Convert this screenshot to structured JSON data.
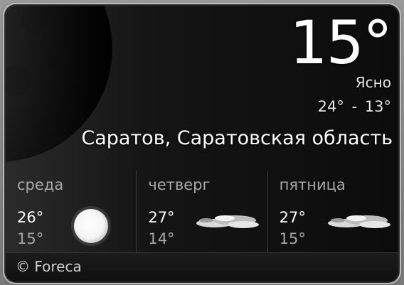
{
  "current": {
    "temperature": "15°",
    "condition": "Ясно",
    "range": "24° - 13°",
    "location": "Саратов, Саратовская область",
    "background_icon": "moon-icon"
  },
  "forecast": [
    {
      "day": "среда",
      "high": "26°",
      "low": "15°",
      "icon": "sun-icon"
    },
    {
      "day": "четверг",
      "high": "27°",
      "low": "14°",
      "icon": "cloud-icon"
    },
    {
      "day": "пятница",
      "high": "27°",
      "low": "15°",
      "icon": "cloud-icon"
    }
  ],
  "footer": {
    "credit": "© Foreca"
  },
  "colors": {
    "background": "#121212",
    "text": "#f2f2f2",
    "muted": "#a9a9a9"
  }
}
